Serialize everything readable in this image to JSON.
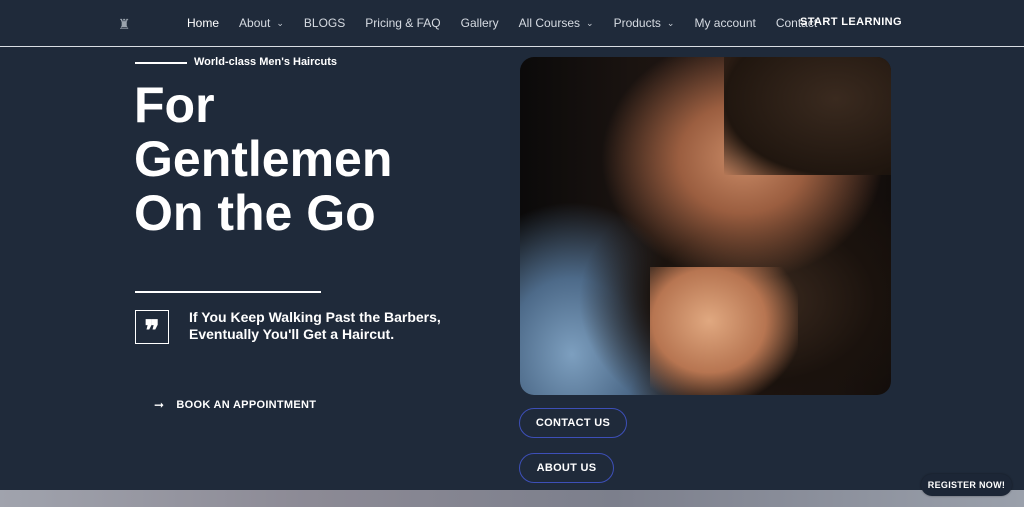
{
  "header": {
    "logo_glyph": "♜",
    "nav": [
      {
        "label": "Home",
        "has_dropdown": false
      },
      {
        "label": "About",
        "has_dropdown": true
      },
      {
        "label": "BLOGS",
        "has_dropdown": false
      },
      {
        "label": "Pricing & FAQ",
        "has_dropdown": false
      },
      {
        "label": "Gallery",
        "has_dropdown": false
      },
      {
        "label": "All Courses",
        "has_dropdown": true
      },
      {
        "label": "Products",
        "has_dropdown": true
      },
      {
        "label": "My account",
        "has_dropdown": false
      },
      {
        "label": "Contact",
        "has_dropdown": false
      }
    ],
    "cta": "START LEARNING"
  },
  "hero": {
    "kicker": "World-class Men's Haircuts",
    "title_lines": [
      "For",
      "Gentlemen",
      "On the Go"
    ],
    "quote_icon": "❞",
    "quote": "If You Keep Walking Past the Barbers, Eventually You'll Get a Haircut.",
    "book_arrow": "➞",
    "book_label": "BOOK AN APPOINTMENT"
  },
  "buttons": {
    "contact": "CONTACT US",
    "about": "ABOUT US"
  },
  "floating": {
    "register": "REGISTER NOW!"
  },
  "colors": {
    "background": "#1f2a3a",
    "button_border": "#3d4fb8",
    "text": "#ffffff"
  }
}
